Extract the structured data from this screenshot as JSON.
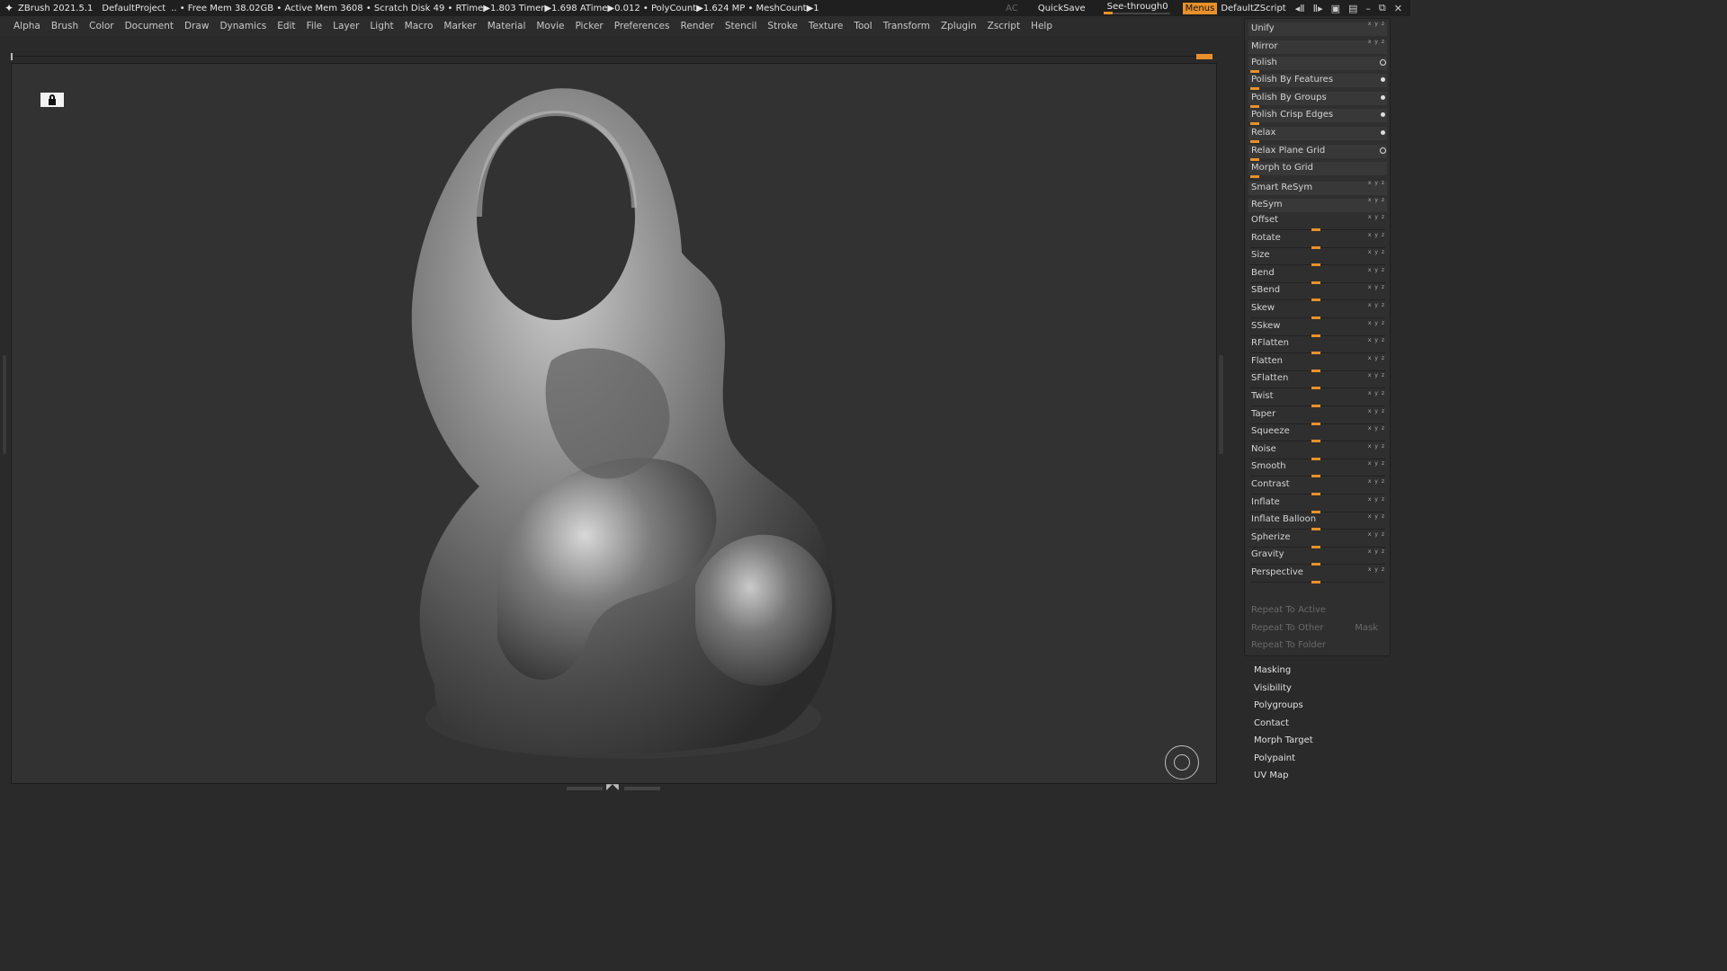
{
  "titlebar": {
    "app": "ZBrush 2021.5.1",
    "project": "DefaultProject",
    "stats": ".. • Free Mem 38.02GB • Active Mem 3608 • Scratch Disk 49 •  RTime▶1.803 Timer▶1.698 ATime▶0.012 • PolyCount▶1.624 MP  • MeshCount▶1",
    "ac": "AC",
    "quicksave": "QuickSave",
    "see_through_label": "See-through",
    "see_through_value": "0",
    "menus": "Menus",
    "script": "DefaultZScript"
  },
  "menubar": [
    "Alpha",
    "Brush",
    "Color",
    "Document",
    "Draw",
    "Dynamics",
    "Edit",
    "File",
    "Layer",
    "Light",
    "Macro",
    "Marker",
    "Material",
    "Movie",
    "Picker",
    "Preferences",
    "Render",
    "Stencil",
    "Stroke",
    "Texture",
    "Tool",
    "Transform",
    "Zplugin",
    "Zscript",
    "Help"
  ],
  "panel": {
    "buttons": [
      {
        "label": "Unify",
        "mark": "xyz"
      },
      {
        "label": "Mirror",
        "mark": "xyz"
      },
      {
        "label": "Polish",
        "mark": "ring",
        "bar": true
      },
      {
        "label": "Polish By Features",
        "mark": "dot",
        "bar": true
      },
      {
        "label": "Polish By Groups",
        "mark": "dot",
        "bar": true
      },
      {
        "label": "Polish Crisp Edges",
        "mark": "dot",
        "bar": true
      },
      {
        "label": "Relax",
        "mark": "dot",
        "bar": true
      },
      {
        "label": "Relax Plane Grid",
        "mark": "ring",
        "bar": true
      },
      {
        "label": "Morph to Grid",
        "mark": "",
        "bar": true
      },
      {
        "label": "Smart ReSym",
        "mark": "xyz"
      },
      {
        "label": "ReSym",
        "mark": "xyz"
      }
    ],
    "sliders": [
      {
        "label": "Offset",
        "value": 0.5
      },
      {
        "label": "Rotate",
        "value": 0.5
      },
      {
        "label": "Size",
        "value": 0.5
      },
      {
        "label": "Bend",
        "value": 0.5
      },
      {
        "label": "SBend",
        "value": 0.5
      },
      {
        "label": "Skew",
        "value": 0.5
      },
      {
        "label": "SSkew",
        "value": 0.5
      },
      {
        "label": "RFlatten",
        "value": 0.5
      },
      {
        "label": "Flatten",
        "value": 0.5
      },
      {
        "label": "SFlatten",
        "value": 0.5
      },
      {
        "label": "Twist",
        "value": 0.5
      },
      {
        "label": "Taper",
        "value": 0.5
      },
      {
        "label": "Squeeze",
        "value": 0.5
      },
      {
        "label": "Noise",
        "value": 0.5
      },
      {
        "label": "Smooth",
        "value": 0.5
      },
      {
        "label": "Contrast",
        "value": 0.5
      },
      {
        "label": "Inflate",
        "value": 0.5
      },
      {
        "label": "Inflate Balloon",
        "value": 0.5
      },
      {
        "label": "Spherize",
        "value": 0.5
      },
      {
        "label": "Gravity",
        "value": 0.5
      },
      {
        "label": "Perspective",
        "value": 0.5
      }
    ],
    "xyz_label": "x y z",
    "repeat_active": "Repeat To Active",
    "repeat_other": "Repeat To Other",
    "mask": "Mask",
    "repeat_folder": "Repeat To Folder"
  },
  "subpalettes": [
    "Masking",
    "Visibility",
    "Polygroups",
    "Contact",
    "Morph Target",
    "Polypaint",
    "UV Map"
  ],
  "colors": {
    "accent": "#e8912b",
    "background": "#323232"
  }
}
